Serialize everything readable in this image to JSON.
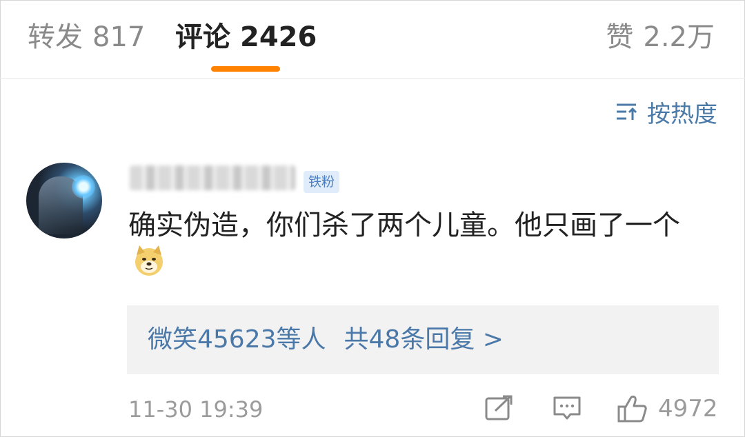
{
  "tabs": {
    "repost": {
      "label": "转发",
      "count": "817"
    },
    "comment": {
      "label": "评论",
      "count": "2426"
    },
    "like": {
      "label": "赞",
      "count": "2.2万"
    }
  },
  "sort": {
    "label": "按热度",
    "icon": "sort-icon"
  },
  "comment": {
    "badge": "铁粉",
    "text": "确实伪造，你们杀了两个儿童。他只画了一个",
    "emoji": "doge-emoji",
    "replies": {
      "liker": "微笑45623等人",
      "summary": "共48条回复 >"
    },
    "time": "11-30 19:39",
    "like_count": "4972"
  },
  "colors": {
    "accent": "#ff8200",
    "link": "#4a78a8",
    "muted": "#9b9b9b"
  }
}
